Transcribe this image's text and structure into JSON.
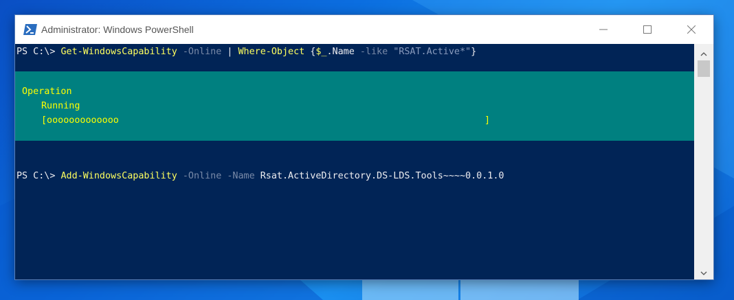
{
  "window": {
    "title": "Administrator: Windows PowerShell"
  },
  "console": {
    "line1": {
      "prompt": "PS C:\\> ",
      "cmd": "Get-WindowsCapability",
      "param": " -Online",
      "pipe": " | ",
      "cmd2": "Where-Object",
      "open": " {",
      "var": "$_",
      "prop": ".Name",
      "op": " -like ",
      "str": "\"RSAT.Active*\"",
      "close": "}"
    },
    "progress": {
      "label": "Operation",
      "status": "Running",
      "bar": "[ooooooooooooo                                                                  ]"
    },
    "line2": {
      "prompt": "PS C:\\> ",
      "cmd": "Add-WindowsCapability",
      "param1": " -Online",
      "param2": " -Name",
      "arg": " Rsat.ActiveDirectory.DS-LDS.Tools~~~~0.0.1.0"
    }
  },
  "colors": {
    "console_bg": "#012456",
    "progress_bg": "#008080",
    "command": "#ffff5f",
    "parameter": "#7a8aa8"
  },
  "icons": {
    "app": "powershell-icon",
    "minimize": "minimize-icon",
    "maximize": "maximize-icon",
    "close": "close-icon",
    "scroll_up": "chevron-up-icon",
    "scroll_down": "chevron-down-icon"
  }
}
